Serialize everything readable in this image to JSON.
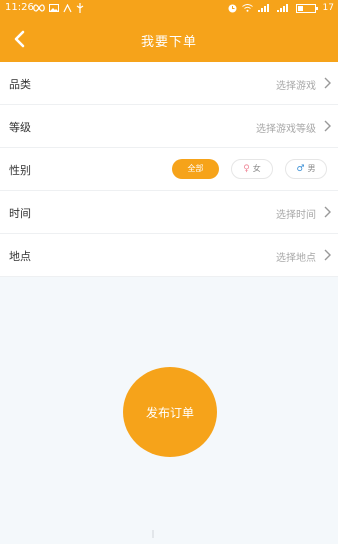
{
  "status_bar": {
    "time": "11:26",
    "battery": "17"
  },
  "header": {
    "title": "我要下单"
  },
  "form": {
    "category": {
      "label": "品类",
      "value": "选择游戏"
    },
    "level": {
      "label": "等级",
      "value": "选择游戏等级"
    },
    "gender": {
      "label": "性别",
      "options": [
        "全部",
        "女",
        "男"
      ],
      "selected": "全部"
    },
    "time": {
      "label": "时间",
      "value": "选择时间"
    },
    "location": {
      "label": "地点",
      "value": "选择地点"
    }
  },
  "publish_button": {
    "label": "发布订单"
  },
  "colors": {
    "accent": "#f6a31a",
    "background": "#f4f8fb",
    "female": "#f08a9a",
    "male": "#3a8fd6"
  },
  "icons": [
    "back-arrow-icon",
    "chevron-right-icon",
    "female-icon",
    "male-icon",
    "wifi-icon",
    "signal-icon",
    "battery-icon"
  ]
}
